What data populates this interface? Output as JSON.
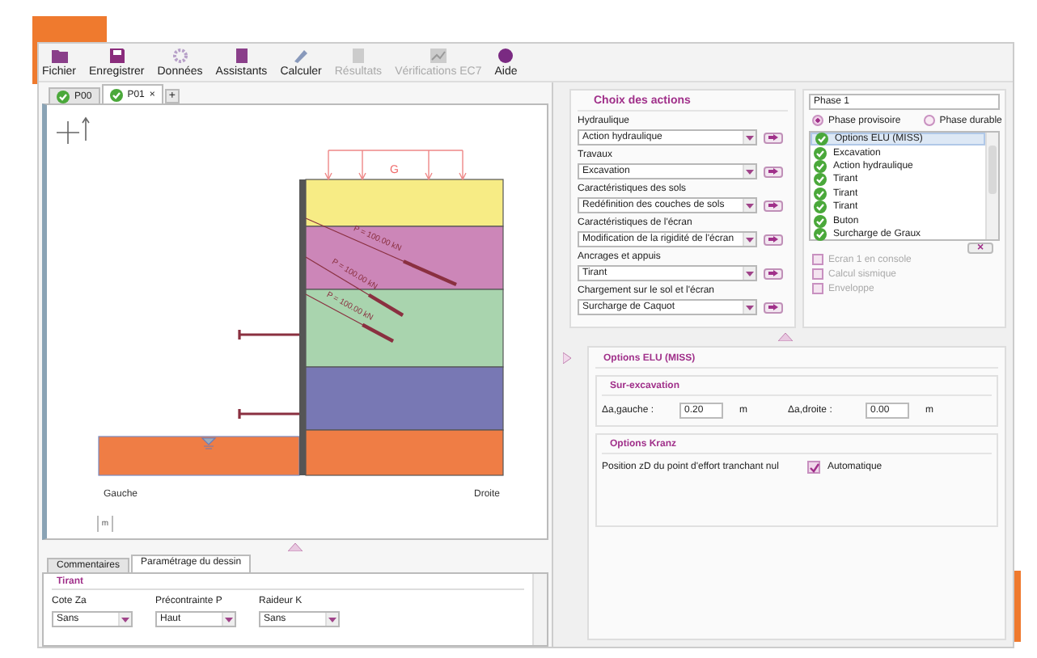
{
  "toolbar": [
    {
      "label": "Fichier",
      "disabled": false
    },
    {
      "label": "Enregistrer",
      "disabled": false
    },
    {
      "label": "Données",
      "disabled": false
    },
    {
      "label": "Assistants",
      "disabled": false
    },
    {
      "label": "Calculer",
      "disabled": false
    },
    {
      "label": "Résultats",
      "disabled": true
    },
    {
      "label": "Vérifications EC7",
      "disabled": true
    },
    {
      "label": "Aide",
      "disabled": false
    }
  ],
  "document_tabs": [
    {
      "label": "P00",
      "selected": false
    },
    {
      "label": "P01",
      "selected": true,
      "close": "×"
    }
  ],
  "add_tab": "+",
  "drawing": {
    "load_label": "G",
    "layers": [
      {
        "color": "#f7ec85"
      },
      {
        "color": "#cc86b8"
      },
      {
        "color": "#a9d4ae"
      },
      {
        "color": "#7878b4"
      },
      {
        "color": "#ef7d45"
      }
    ],
    "anchors": [
      {
        "label": "P = 100.00 kN"
      },
      {
        "label": "P = 100.00 kN"
      },
      {
        "label": "P = 100.00 kN"
      }
    ],
    "left_label": "Gauche",
    "right_label": "Droite",
    "unit": "m"
  },
  "bottom_tabs": [
    {
      "label": "Commentaires",
      "selected": false
    },
    {
      "label": "Paramétrage du dessin",
      "selected": true
    }
  ],
  "tirant_panel": {
    "title": "Tirant",
    "fields": [
      {
        "label": "Cote Za",
        "value": "Sans"
      },
      {
        "label": "Précontrainte P",
        "value": "Haut"
      },
      {
        "label": "Raideur K",
        "value": "Sans"
      }
    ]
  },
  "actions": {
    "title": "Choix des actions",
    "groups": [
      {
        "label": "Hydraulique",
        "value": "Action hydraulique"
      },
      {
        "label": "Travaux",
        "value": "Excavation"
      },
      {
        "label": "Caractéristiques des sols",
        "value": "Redéfinition des couches de sols"
      },
      {
        "label": "Caractéristiques de l'écran",
        "value": "Modification de la rigidité de l'écran"
      },
      {
        "label": "Ancrages et appuis",
        "value": "Tirant"
      },
      {
        "label": "Chargement sur le sol et l'écran",
        "value": "Surcharge de Caquot"
      }
    ]
  },
  "phase": {
    "name": "Phase 1",
    "options": [
      {
        "label": "Phase provisoire",
        "selected": true
      },
      {
        "label": "Phase durable",
        "selected": false
      }
    ],
    "list": [
      {
        "label": "Options ELU (MISS)",
        "selected": true
      },
      {
        "label": "Excavation",
        "selected": false
      },
      {
        "label": "Action hydraulique",
        "selected": false
      },
      {
        "label": "Tirant",
        "selected": false
      },
      {
        "label": "Tirant",
        "selected": false
      },
      {
        "label": "Tirant",
        "selected": false
      },
      {
        "label": "Buton",
        "selected": false
      },
      {
        "label": "Surcharge de Graux",
        "selected": false
      }
    ],
    "remove": "×",
    "checks": [
      {
        "label": "Ecran 1 en console",
        "checked": false,
        "disabled": true
      },
      {
        "label": "Calcul sismique",
        "checked": false,
        "disabled": true
      },
      {
        "label": "Enveloppe",
        "checked": false,
        "disabled": true
      }
    ]
  },
  "options_elu": {
    "title": "Options ELU (MISS)",
    "sur_excavation": {
      "title": "Sur-excavation",
      "fields": [
        {
          "label": "Δa,gauche :",
          "value": "0.20",
          "unit": "m"
        },
        {
          "label": "Δa,droite :",
          "value": "0.00",
          "unit": "m"
        }
      ]
    },
    "kranz": {
      "title": "Options Kranz",
      "label": "Position zD du point d'effort tranchant nul",
      "checkbox": {
        "label": "Automatique",
        "checked": true
      }
    }
  }
}
